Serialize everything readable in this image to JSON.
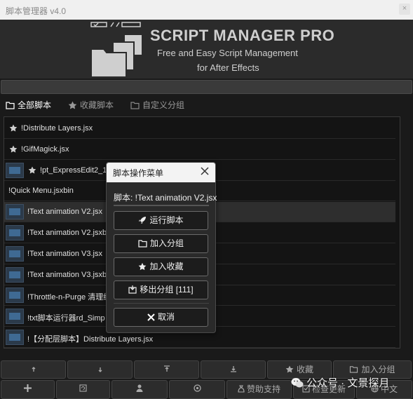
{
  "window": {
    "title": "脚本管理器 v4.0",
    "close_label": "×"
  },
  "header": {
    "brand": "SCRIPT MANAGER PRO",
    "subtitle_line1": "Free and Easy Script Management",
    "subtitle_line2": "for After Effects"
  },
  "tabs": [
    {
      "label": "全部脚本",
      "icon": "folder-icon",
      "active": true
    },
    {
      "label": "收藏脚本",
      "icon": "star-icon",
      "active": false
    },
    {
      "label": "自定义分组",
      "icon": "folder-outline-icon",
      "active": false
    }
  ],
  "scripts": [
    {
      "name": "!Distribute Layers.jsx",
      "starred": true,
      "thumb": false
    },
    {
      "name": "!GifMagick.jsx",
      "starred": true,
      "thumb": false
    },
    {
      "name": "!pt_ExpressEdit2_15",
      "starred": true,
      "thumb": true
    },
    {
      "name": "!Quick Menu.jsxbin",
      "starred": false,
      "thumb": false
    },
    {
      "name": "!Text animation V2.jsx",
      "starred": false,
      "thumb": true,
      "selected": true
    },
    {
      "name": "!Text animation V2.jsxbi",
      "starred": false,
      "thumb": true
    },
    {
      "name": "!Text animation V3.jsx",
      "starred": false,
      "thumb": true
    },
    {
      "name": "!Text animation V3.jsxbi",
      "starred": false,
      "thumb": true
    },
    {
      "name": "!Throttle-n-Purge 清理缓",
      "starred": false,
      "thumb": true
    },
    {
      "name": "!txt脚本运行器rd_Simp",
      "starred": false,
      "thumb": true
    },
    {
      "name": "!【分配层脚本】Distribute Layers.jsx",
      "starred": false,
      "thumb": true
    }
  ],
  "dialog": {
    "title": "脚本操作菜单",
    "script_label": "脚本: !Text animation V2.jsx",
    "buttons": [
      {
        "label": "运行脚本",
        "icon": "rocket-icon"
      },
      {
        "label": "加入分组",
        "icon": "folder-icon"
      },
      {
        "label": "加入收藏",
        "icon": "star-icon"
      },
      {
        "label": "移出分组 [111]",
        "icon": "remove-box-icon"
      },
      {
        "label": "取消",
        "icon": "x-icon"
      }
    ]
  },
  "toolbar_top": [
    {
      "label": "",
      "icon": "up-arrow-icon"
    },
    {
      "label": "",
      "icon": "down-arrow-icon"
    },
    {
      "label": "",
      "icon": "move-top-icon"
    },
    {
      "label": "",
      "icon": "move-end-icon"
    },
    {
      "label": "收藏",
      "icon": "star-icon"
    },
    {
      "label": "加入分组",
      "icon": "folder-icon"
    }
  ],
  "toolbar_bottom": [
    {
      "label": "",
      "icon": "plus-icon"
    },
    {
      "label": "",
      "icon": "refresh-icon"
    },
    {
      "label": "",
      "icon": "user-icon"
    },
    {
      "label": "",
      "icon": "settings-icon"
    },
    {
      "label": "赞助支持",
      "icon": "sponsor-icon"
    },
    {
      "label": "检查更新",
      "icon": "update-icon"
    },
    {
      "label": "中文",
      "icon": "globe-icon"
    }
  ],
  "watermark": "公众号 · 文景探月"
}
